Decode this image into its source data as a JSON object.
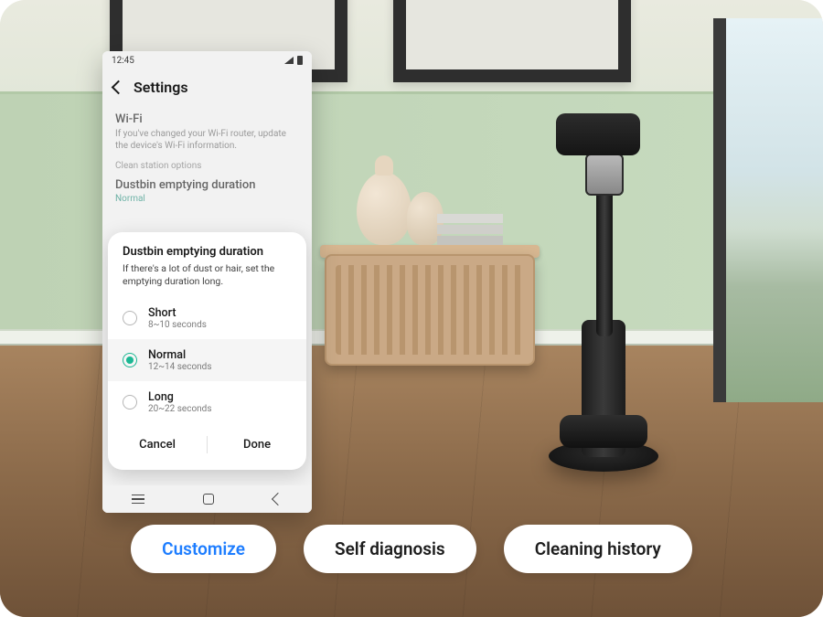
{
  "statusbar": {
    "time": "12:45"
  },
  "appbar": {
    "title": "Settings"
  },
  "settings": {
    "wifi": {
      "title": "Wi-Fi",
      "desc": "If you've changed your Wi-Fi router, update the device's Wi-Fi information."
    },
    "section_label": "Clean station options",
    "dustbin": {
      "title": "Dustbin emptying duration",
      "current": "Normal"
    }
  },
  "dialog": {
    "title": "Dustbin emptying duration",
    "desc": "If there's a lot of dust or hair, set the emptying duration long.",
    "options": [
      {
        "label": "Short",
        "detail": "8~10 seconds",
        "selected": false
      },
      {
        "label": "Normal",
        "detail": "12~14 seconds",
        "selected": true
      },
      {
        "label": "Long",
        "detail": "20~22 seconds",
        "selected": false
      }
    ],
    "cancel": "Cancel",
    "done": "Done"
  },
  "pills": {
    "items": [
      {
        "label": "Customize",
        "active": true
      },
      {
        "label": "Self diagnosis",
        "active": false
      },
      {
        "label": "Cleaning history",
        "active": false
      }
    ]
  }
}
